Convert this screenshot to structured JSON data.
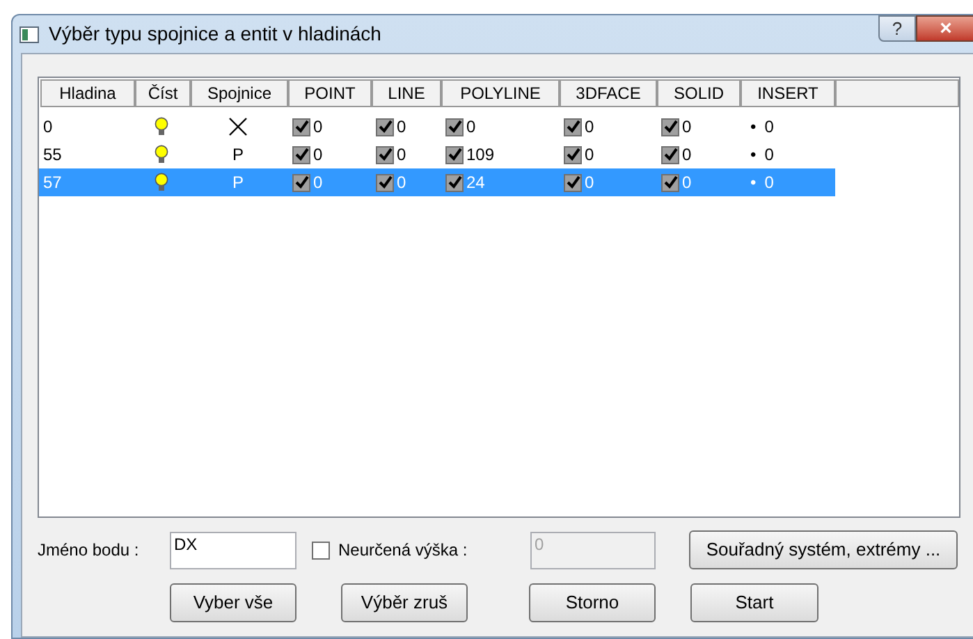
{
  "window": {
    "title": "Výběr typu spojnice a entit v hladinách",
    "help_button": "?",
    "close_button": "×"
  },
  "table": {
    "columns": [
      "Hladina",
      "Číst",
      "Spojnice",
      "POINT",
      "LINE",
      "POLYLINE",
      "3DFACE",
      "SOLID",
      "INSERT"
    ],
    "rows": [
      {
        "selected": false,
        "layer": "0",
        "read": true,
        "link": {
          "kind": "cross"
        },
        "point": {
          "checked": true,
          "count": "0"
        },
        "line": {
          "checked": true,
          "count": "0"
        },
        "polyline": {
          "checked": true,
          "count": "0"
        },
        "face3d": {
          "checked": true,
          "count": "0"
        },
        "solid": {
          "checked": true,
          "count": "0"
        },
        "insert": {
          "bullet": "•",
          "count": "0"
        }
      },
      {
        "selected": false,
        "layer": "55",
        "read": true,
        "link": {
          "kind": "text",
          "text": "P"
        },
        "point": {
          "checked": true,
          "count": "0"
        },
        "line": {
          "checked": true,
          "count": "0"
        },
        "polyline": {
          "checked": true,
          "count": "109"
        },
        "face3d": {
          "checked": true,
          "count": "0"
        },
        "solid": {
          "checked": true,
          "count": "0"
        },
        "insert": {
          "bullet": "•",
          "count": "0"
        }
      },
      {
        "selected": true,
        "layer": "57",
        "read": true,
        "link": {
          "kind": "text",
          "text": "P"
        },
        "point": {
          "checked": true,
          "count": "0"
        },
        "line": {
          "checked": true,
          "count": "0"
        },
        "polyline": {
          "checked": true,
          "count": "24"
        },
        "face3d": {
          "checked": true,
          "count": "0"
        },
        "solid": {
          "checked": true,
          "count": "0"
        },
        "insert": {
          "bullet": "•",
          "count": "0"
        }
      }
    ]
  },
  "point_name": {
    "label": "Jméno bodu :",
    "value": "DX"
  },
  "undefined_height": {
    "label": "Neurčená výška :",
    "checked": false,
    "value": "0",
    "disabled": true
  },
  "buttons": [
    "Souřadný systém, extrémy ...",
    "Vyber vše",
    "Výběr zruš",
    "Storno",
    "Start"
  ]
}
